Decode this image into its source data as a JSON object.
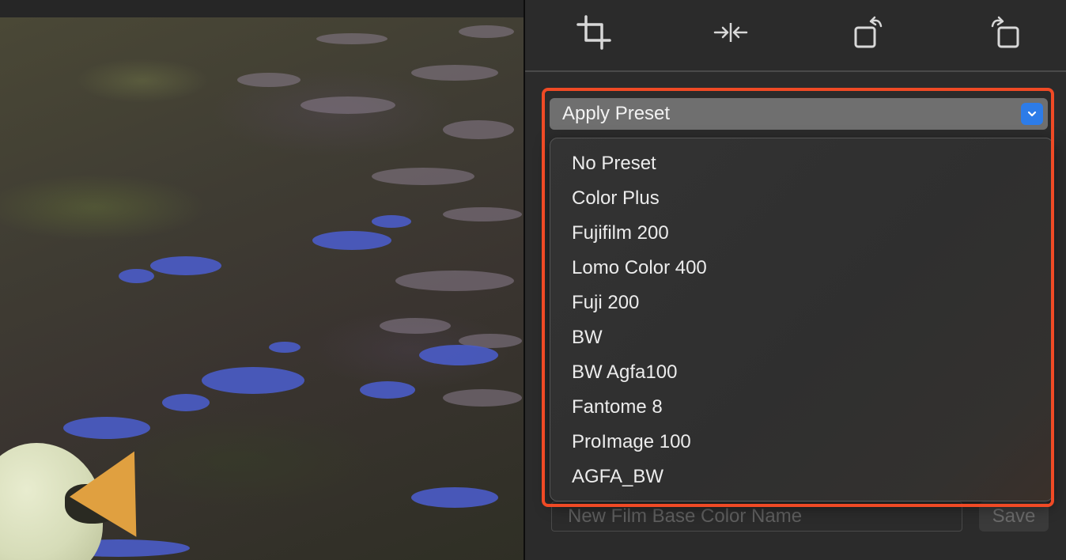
{
  "toolbar": {
    "icons": [
      "crop-icon",
      "flip-horizontal-icon",
      "rotate-left-icon",
      "rotate-right-icon"
    ]
  },
  "presets": {
    "select_label": "Apply Preset",
    "items": [
      "No Preset",
      "Color Plus",
      "Fujifilm 200",
      "Lomo Color 400",
      "Fuji 200",
      "BW",
      "BW Agfa100",
      "Fantome 8",
      "ProImage 100",
      "AGFA_BW"
    ]
  },
  "film_base": {
    "placeholder": "New Film Base Color Name",
    "save_label": "Save"
  },
  "colors": {
    "highlight": "#f04a25",
    "accent": "#2d7ce8"
  }
}
